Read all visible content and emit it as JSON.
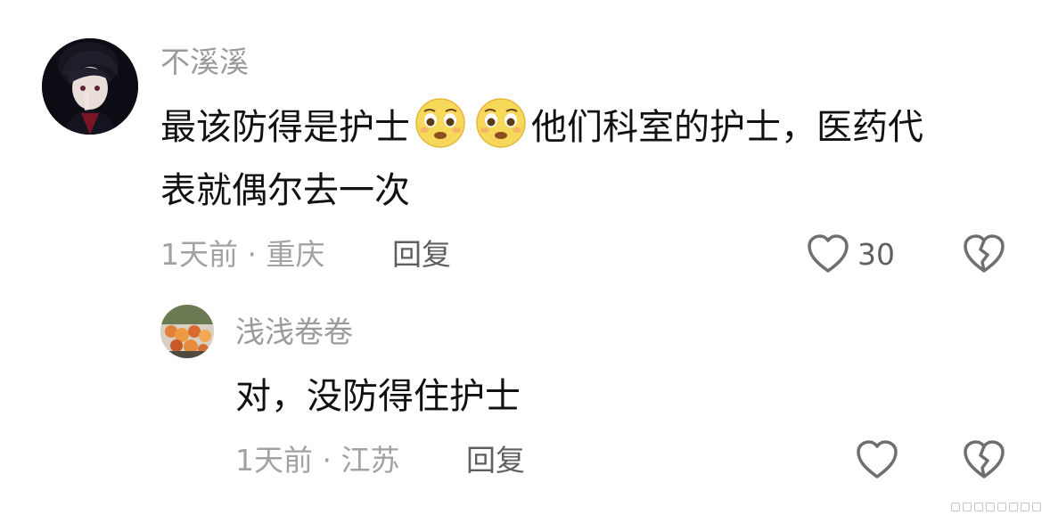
{
  "comment": {
    "username": "不溪溪",
    "content_part1": "最该防得是护士",
    "content_part2": "他们科室的护士，医药代",
    "content_line2": "表就偶尔去一次",
    "emoji_names": [
      "pleading-face-icon",
      "pleading-face-icon"
    ],
    "meta": "1天前 · 重庆",
    "reply_label": "回复",
    "like_count": "30"
  },
  "reply": {
    "username": "浅浅卷卷",
    "content": "对，没防得住护士",
    "meta": "1天前 · 江苏",
    "reply_label": "回复"
  },
  "colors": {
    "username": "#9a9a9a",
    "text": "#111111",
    "meta": "#a2a2a2",
    "icon": "#6f6f6f"
  }
}
